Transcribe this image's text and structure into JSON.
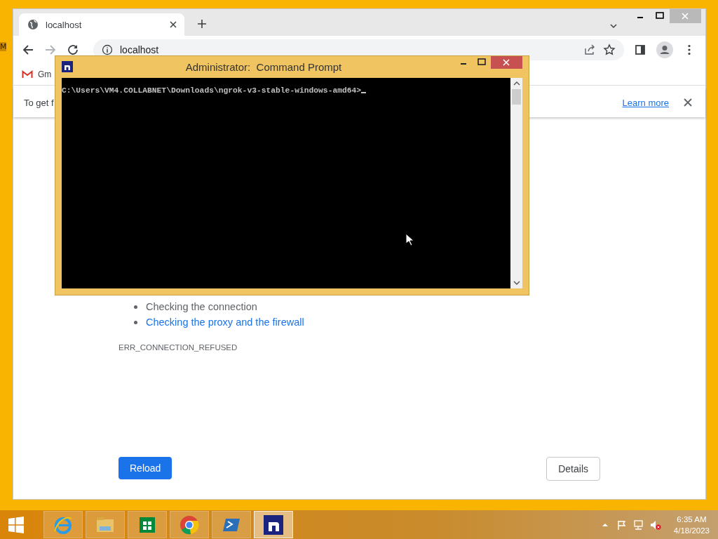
{
  "desktop": {
    "label": "M"
  },
  "browser": {
    "tab": {
      "title": "localhost",
      "selected": true
    },
    "address": "localhost",
    "bookmarks": [
      "Gm"
    ],
    "infobar": {
      "text": "To get f",
      "link": "Learn more"
    },
    "page": {
      "suggestions": [
        {
          "text": "Checking the connection",
          "kind": "text"
        },
        {
          "text": "Checking the proxy and the firewall",
          "kind": "link"
        }
      ],
      "error_code": "ERR_CONNECTION_REFUSED",
      "buttons": [
        {
          "label": "Reload",
          "kind": "primary"
        },
        {
          "label": "Details",
          "kind": "secondary"
        }
      ]
    }
  },
  "console": {
    "title": "Administrator:  Command Prompt",
    "lines": [
      "C:\\Users\\VM4.COLLABNET\\Downloads\\ngrok-v3-stable-windows-amd64>"
    ]
  },
  "taskbar": {
    "apps": [
      {
        "kind": "ie",
        "selected": false
      },
      {
        "kind": "explorer",
        "selected": false
      },
      {
        "kind": "store",
        "selected": false
      },
      {
        "kind": "chrome",
        "selected": false
      },
      {
        "kind": "powershell",
        "selected": false
      },
      {
        "kind": "ngrok",
        "selected": true
      }
    ],
    "time": "6:35 AM",
    "date": "4/18/2023"
  }
}
